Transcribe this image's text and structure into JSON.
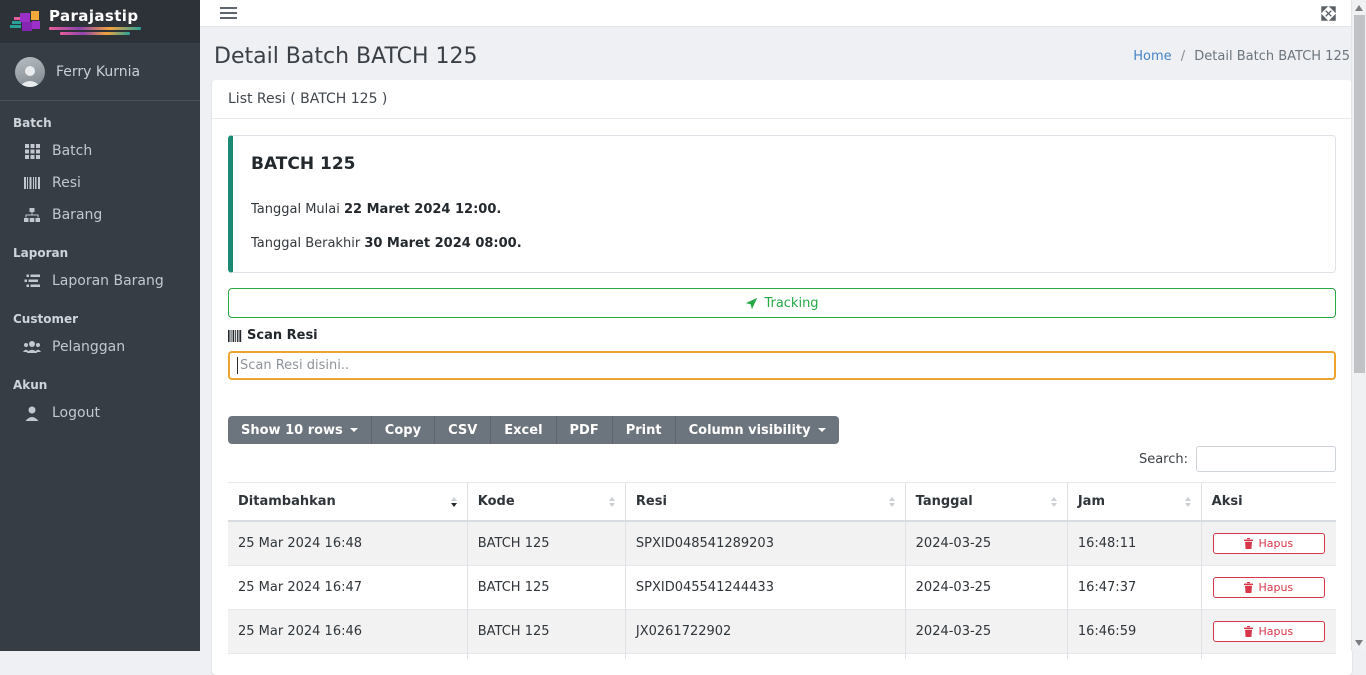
{
  "brand": {
    "name": "Parajastip"
  },
  "user": {
    "name": "Ferry Kurnia"
  },
  "sidebar": {
    "sections": [
      {
        "header": "Batch",
        "items": [
          {
            "label": "Batch",
            "icon": "grid-icon"
          },
          {
            "label": "Resi",
            "icon": "barcode-icon"
          },
          {
            "label": "Barang",
            "icon": "sitemap-icon"
          }
        ]
      },
      {
        "header": "Laporan",
        "items": [
          {
            "label": "Laporan Barang",
            "icon": "list-icon"
          }
        ]
      },
      {
        "header": "Customer",
        "items": [
          {
            "label": "Pelanggan",
            "icon": "users-icon"
          }
        ]
      },
      {
        "header": "Akun",
        "items": [
          {
            "label": "Logout",
            "icon": "user-icon"
          }
        ]
      }
    ]
  },
  "page": {
    "title": "Detail Batch BATCH 125",
    "breadcrumb": {
      "home": "Home",
      "separator": "/",
      "current": "Detail Batch BATCH 125"
    }
  },
  "card": {
    "header": "List Resi ( BATCH 125 )"
  },
  "batch_info": {
    "title": "BATCH 125",
    "start_label": "Tanggal Mulai",
    "start_value": "22 Maret 2024 12:00.",
    "end_label": "Tanggal Berakhir",
    "end_value": "30 Maret 2024 08:00."
  },
  "tracking": {
    "label": "Tracking"
  },
  "scan": {
    "label": "Scan Resi",
    "placeholder": "Scan Resi disini.."
  },
  "toolbar": {
    "buttons": [
      "Show 10 rows",
      "Copy",
      "CSV",
      "Excel",
      "PDF",
      "Print",
      "Column visibility"
    ]
  },
  "search": {
    "label": "Search:",
    "value": ""
  },
  "table": {
    "columns": [
      "Ditambahkan",
      "Kode",
      "Resi",
      "Tanggal",
      "Jam",
      "Aksi"
    ],
    "sorted_column": "Ditambahkan",
    "sort_direction": "desc",
    "rows": [
      {
        "ditambahkan": "25 Mar 2024 16:48",
        "kode": "BATCH 125",
        "resi": "SPXID048541289203",
        "tanggal": "2024-03-25",
        "jam": "16:48:11",
        "aksi": "Hapus"
      },
      {
        "ditambahkan": "25 Mar 2024 16:47",
        "kode": "BATCH 125",
        "resi": "SPXID045541244433",
        "tanggal": "2024-03-25",
        "jam": "16:47:37",
        "aksi": "Hapus"
      },
      {
        "ditambahkan": "25 Mar 2024 16:46",
        "kode": "BATCH 125",
        "resi": "JX0261722902",
        "tanggal": "2024-03-25",
        "jam": "16:46:59",
        "aksi": "Hapus"
      }
    ]
  },
  "colors": {
    "accent_green": "#28a745",
    "warning_border": "#eda52f",
    "danger": "#d93749",
    "callout_teal": "#1d8a78",
    "link_blue": "#4584c6",
    "button_gray": "#6c757d",
    "sidebar_bg": "#373d44"
  }
}
